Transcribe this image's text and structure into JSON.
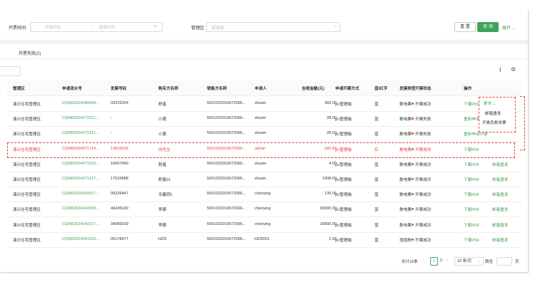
{
  "filters": {
    "date_label": "开票时间:",
    "start_placeholder": "开始时间",
    "end_placeholder": "结束时间",
    "area_label": "管理区:",
    "area_placeholder": "请选择",
    "reset_label": "重 置",
    "search_label": "查 询",
    "expand_label": "展开"
  },
  "tab_label": "开票失败(2)",
  "columns": [
    "管理区",
    "申请流水号",
    "发票号码",
    "购买方名称",
    "销售方名称",
    "申请人",
    "含税金额(元)",
    "申请开票方式",
    "蓝/红字",
    "发票类型",
    "开票状态",
    "操作"
  ],
  "rows": [
    {
      "area": "演示住宅管理区",
      "serial": "CQNB20240806​09...",
      "inv": "09225324",
      "buyer": "舒鑫",
      "seller": "50010220100720​66...",
      "applicant": "shuxin",
      "amount": "360.00",
      "method": "pc管理端",
      "color": "蓝",
      "type": "数电票",
      "status": "开票成功",
      "op1": "下载PDF",
      "op2": "更多"
    },
    {
      "area": "演示住宅管理区",
      "serial": "CQNB202407221​1...",
      "inv": "-",
      "buyer": "小黄",
      "seller": "50010220100720​66...",
      "applicant": "shuxin",
      "amount": "28.00",
      "method": "pc管理端",
      "color": "蓝",
      "type": "数电票",
      "status": "开票失败",
      "op1": "重新申请",
      "op2": ""
    },
    {
      "area": "演示住宅管理区",
      "serial": "CQNB202407221​1...",
      "inv": "-",
      "buyer": "小黄",
      "seller": "50010220100720​66...",
      "applicant": "shuxin",
      "amount": "28.00",
      "method": "pc管理端",
      "color": "蓝",
      "type": "数电票",
      "status": "开票失败",
      "op1": "重新申请开票",
      "op2": ""
    },
    {
      "area": "演示住宅管理区",
      "serial": "CQNB202407171​4...",
      "inv": "14502635",
      "buyer": "向先生",
      "seller": "50010220100720​66...",
      "applicant": "admin",
      "amount": "-182.84",
      "method": "pc管理端",
      "color": "红",
      "type": "数电票",
      "status": "开票成功",
      "op1": "下载PDF",
      "op2": ""
    },
    {
      "area": "演示住宅管理区",
      "serial": "CQNB202407151​5...",
      "inv": "16007460",
      "buyer": "舒鑫",
      "seller": "50010220100720​66...",
      "applicant": "shuxin",
      "amount": "4.00",
      "method": "pc管理端",
      "color": "蓝",
      "type": "数电票",
      "status": "开票成功",
      "op1": "下载PDF",
      "op2": "邮箱重发"
    },
    {
      "area": "演示住宅管理区",
      "serial": "CQNB202407121​7...",
      "inv": "17533988",
      "buyer": "舒鑫01",
      "seller": "50010220100720​66...",
      "applicant": "shuxin",
      "amount": "1008.00",
      "method": "pc管理端",
      "color": "蓝",
      "type": "数电票",
      "status": "开票成功",
      "op1": "下载PDF",
      "op2": "邮箱重发"
    },
    {
      "area": "演示住宅管理区",
      "serial": "CQNB202405091​7...",
      "inv": "09226447",
      "buyer": "韦馨钥1",
      "seller": "50010220100720​66...",
      "applicant": "chenying",
      "amount": "130.06",
      "method": "pc管理端",
      "color": "蓝",
      "type": "数电票",
      "status": "开票成功",
      "op1": "下载PDF",
      "op2": "邮箱重发"
    },
    {
      "area": "演示住宅管理区",
      "serial": "CQNB202404250​9...",
      "inv": "46245199",
      "buyer": "李朝",
      "seller": "50010220100720​66...",
      "applicant": "chenying",
      "amount": "30000.00",
      "method": "pc管理端",
      "color": "蓝",
      "type": "数电票",
      "status": "开票成功",
      "op1": "下载PDF",
      "op2": "邮箱重发"
    },
    {
      "area": "演示住宅管理区",
      "serial": "CQNB202404221​7...",
      "inv": "34085209",
      "buyer": "李朝",
      "seller": "50010220100720​66...",
      "applicant": "chenying",
      "amount": "30000.00",
      "method": "pc管理端",
      "color": "蓝",
      "type": "数电票",
      "status": "开票成功",
      "op1": "下载PDF",
      "op2": "邮箱重发"
    },
    {
      "area": "演示住宅管理区",
      "serial": "CQNB202404101​0...",
      "inv": "05178477",
      "buyer": "HZD",
      "seller": "50010220100720​66...",
      "applicant": "HZD001",
      "amount": "1.00",
      "method": "pc管理端",
      "color": "蓝",
      "type": "增值税",
      "status": "开票成功",
      "op1": "下载PDF",
      "op2": "邮箱重发"
    }
  ],
  "dropdown": {
    "item1": "邮箱重发",
    "item2": "开具负数发票"
  },
  "pager": {
    "total": "总计15条",
    "page1": "1",
    "page2": "2",
    "size": "10 条/页",
    "jump": "跳至",
    "page_unit": "页"
  }
}
